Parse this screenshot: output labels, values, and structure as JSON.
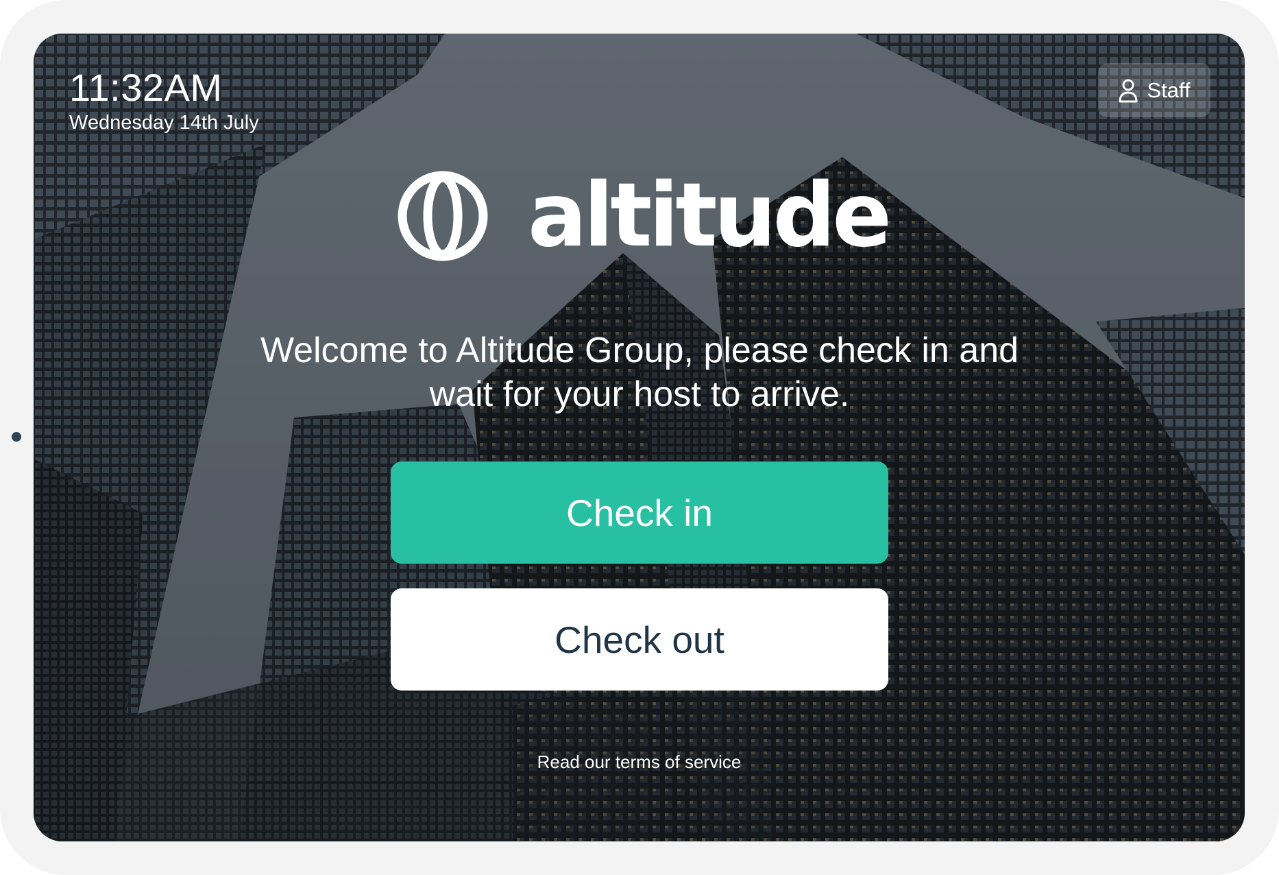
{
  "status": {
    "time": "11:32AM",
    "date": "Wednesday 14th July"
  },
  "staff_button": {
    "label": "Staff",
    "icon": "user-icon"
  },
  "brand": {
    "logo_icon": "globe-mark-icon",
    "name": "altitude"
  },
  "welcome_message": "Welcome to Altitude Group, please check in and wait for your host to arrive.",
  "actions": {
    "check_in_label": "Check in",
    "check_out_label": "Check out"
  },
  "footer": {
    "terms_link": "Read our terms of service"
  },
  "colors": {
    "primary": "#27c0a3",
    "text_dark": "#1f3547",
    "device_frame": "#f3f3f3"
  }
}
